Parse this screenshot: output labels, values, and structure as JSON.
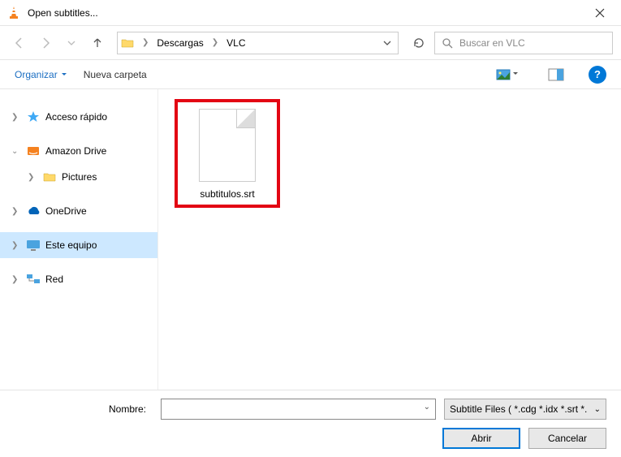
{
  "window": {
    "title": "Open subtitles..."
  },
  "nav": {
    "breadcrumb": [
      "Descargas",
      "VLC"
    ],
    "search_placeholder": "Buscar en VLC"
  },
  "toolbar": {
    "organize_label": "Organizar",
    "new_folder_label": "Nueva carpeta"
  },
  "tree": {
    "items": [
      {
        "label": "Acceso rápido",
        "icon": "star",
        "expanded": false,
        "selected": false,
        "child": false
      },
      {
        "label": "Amazon Drive",
        "icon": "amazon",
        "expanded": true,
        "selected": false,
        "child": false
      },
      {
        "label": "Pictures",
        "icon": "folder",
        "expanded": false,
        "selected": false,
        "child": true
      },
      {
        "label": "OneDrive",
        "icon": "cloud",
        "expanded": false,
        "selected": false,
        "child": false
      },
      {
        "label": "Este equipo",
        "icon": "pc",
        "expanded": false,
        "selected": true,
        "child": false
      },
      {
        "label": "Red",
        "icon": "network",
        "expanded": false,
        "selected": false,
        "child": false
      }
    ]
  },
  "content": {
    "files": [
      {
        "name": "subtitulos.srt",
        "highlighted": true
      }
    ]
  },
  "footer": {
    "name_label": "Nombre:",
    "name_value": "",
    "filter_label": "Subtitle Files ( *.cdg *.idx *.srt *.",
    "open_label": "Abrir",
    "cancel_label": "Cancelar"
  }
}
